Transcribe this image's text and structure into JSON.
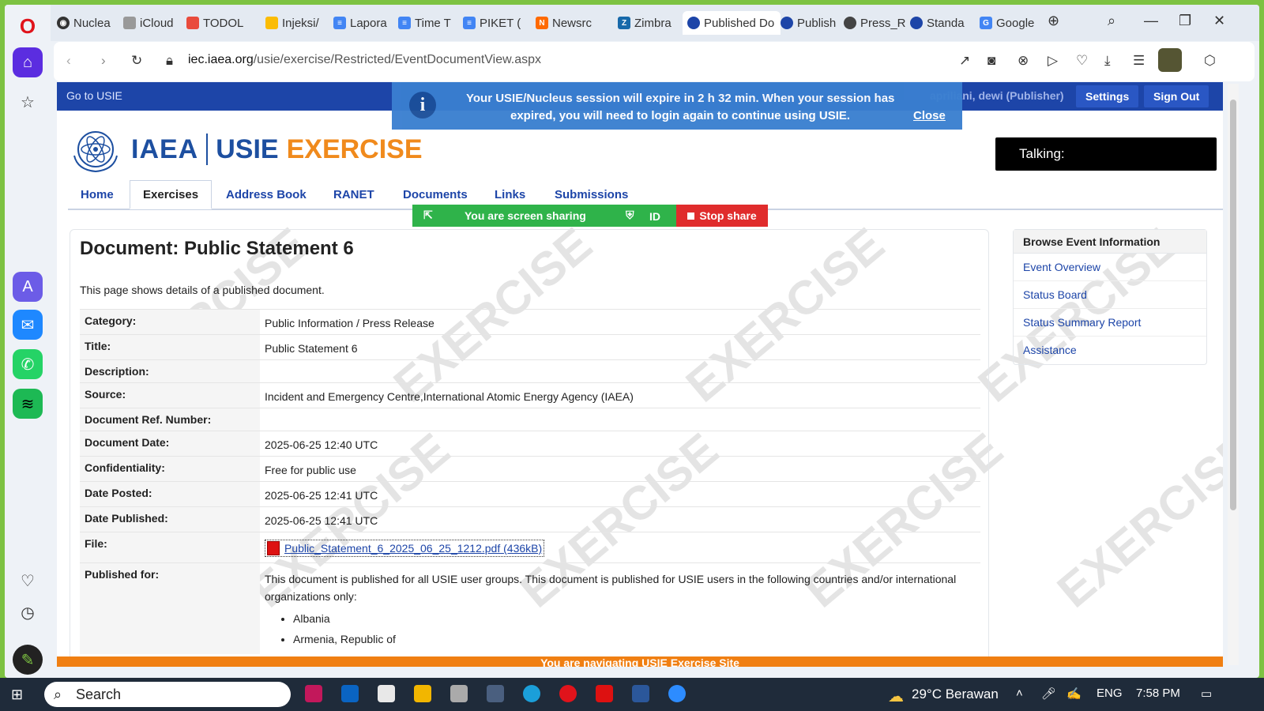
{
  "browser": {
    "tabs": [
      {
        "label": "Nuclea",
        "color": "#333"
      },
      {
        "label": "iCloud",
        "color": "#555"
      },
      {
        "label": "TODOL",
        "color": "#e94b3c"
      },
      {
        "label": "Injeksi/",
        "color": "#1a73e8"
      },
      {
        "label": "Lapora",
        "color": "#4285f4"
      },
      {
        "label": "Time T",
        "color": "#4285f4"
      },
      {
        "label": "PIKET (",
        "color": "#4285f4"
      },
      {
        "label": "Newsrc",
        "color": "#ff6a00"
      },
      {
        "label": "Zimbra",
        "color": "#1769aa"
      },
      {
        "label": "Published Do",
        "color": "#1d45a8"
      },
      {
        "label": "Publish",
        "color": "#1d45a8"
      },
      {
        "label": "Press_R",
        "color": "#444"
      },
      {
        "label": "Standa",
        "color": "#1d45a8"
      },
      {
        "label": "Google",
        "color": "#4285f4"
      }
    ],
    "url_host": "iec.iaea.org",
    "url_path": "/usie/exercise/Restricted/EventDocumentView.aspx"
  },
  "page": {
    "go_to": "Go to USIE",
    "user": "apriliani, dewi (Publisher)",
    "settings": "Settings",
    "sign_out": "Sign Out",
    "banner_line1": "Your USIE/Nucleus session will expire in 2 h 32 min. When your session has",
    "banner_line2": "expired, you will need to login again to continue using USIE.",
    "banner_close": "Close",
    "talking": "Talking:",
    "logo_iaea": "IAEA",
    "logo_usie": "USIE",
    "logo_exercise": "EXERCISE",
    "nav": [
      "Home",
      "Exercises",
      "Address Book",
      "RANET",
      "Documents",
      "Links",
      "Submissions"
    ],
    "share_text": "You are screen sharing",
    "share_id": "ID",
    "stop_share": "Stop share",
    "heading": "Document: Public Statement 6",
    "intro": "This page shows details of a published document.",
    "details": {
      "category_label": "Category:",
      "category": "Public Information / Press Release",
      "title_label": "Title:",
      "title": "Public Statement 6",
      "description_label": "Description:",
      "source_label": "Source:",
      "source": "Incident and Emergency Centre,International Atomic Energy Agency (IAEA)",
      "ref_label": "Document Ref. Number:",
      "date_label": "Document Date:",
      "date": "2025-06-25 12:40 UTC",
      "conf_label": "Confidentiality:",
      "conf": "Free for public use",
      "posted_label": "Date Posted:",
      "posted": "2025-06-25 12:41 UTC",
      "published_label": "Date Published:",
      "published": "2025-06-25 12:41 UTC",
      "file_label": "File:",
      "file": "Public_Statement_6_2025_06_25_1212.pdf (436kB)",
      "pubfor_label": "Published for:",
      "pubfor": "This document is published for all USIE user groups. This document is published for USIE users in the following countries and/or international organizations only:",
      "countries": [
        "Albania",
        "Armenia, Republic of"
      ]
    },
    "browse_title": "Browse Event Information",
    "browse_links": [
      "Event Overview",
      "Status Board",
      "Status Summary Report",
      "Assistance"
    ],
    "watermark": "EXERCISE",
    "footer": "You are navigating USIE Exercise Site"
  },
  "taskbar": {
    "search": "Search",
    "weather": "29°C  Berawan",
    "lang": "ENG",
    "time": "7:58 PM"
  }
}
